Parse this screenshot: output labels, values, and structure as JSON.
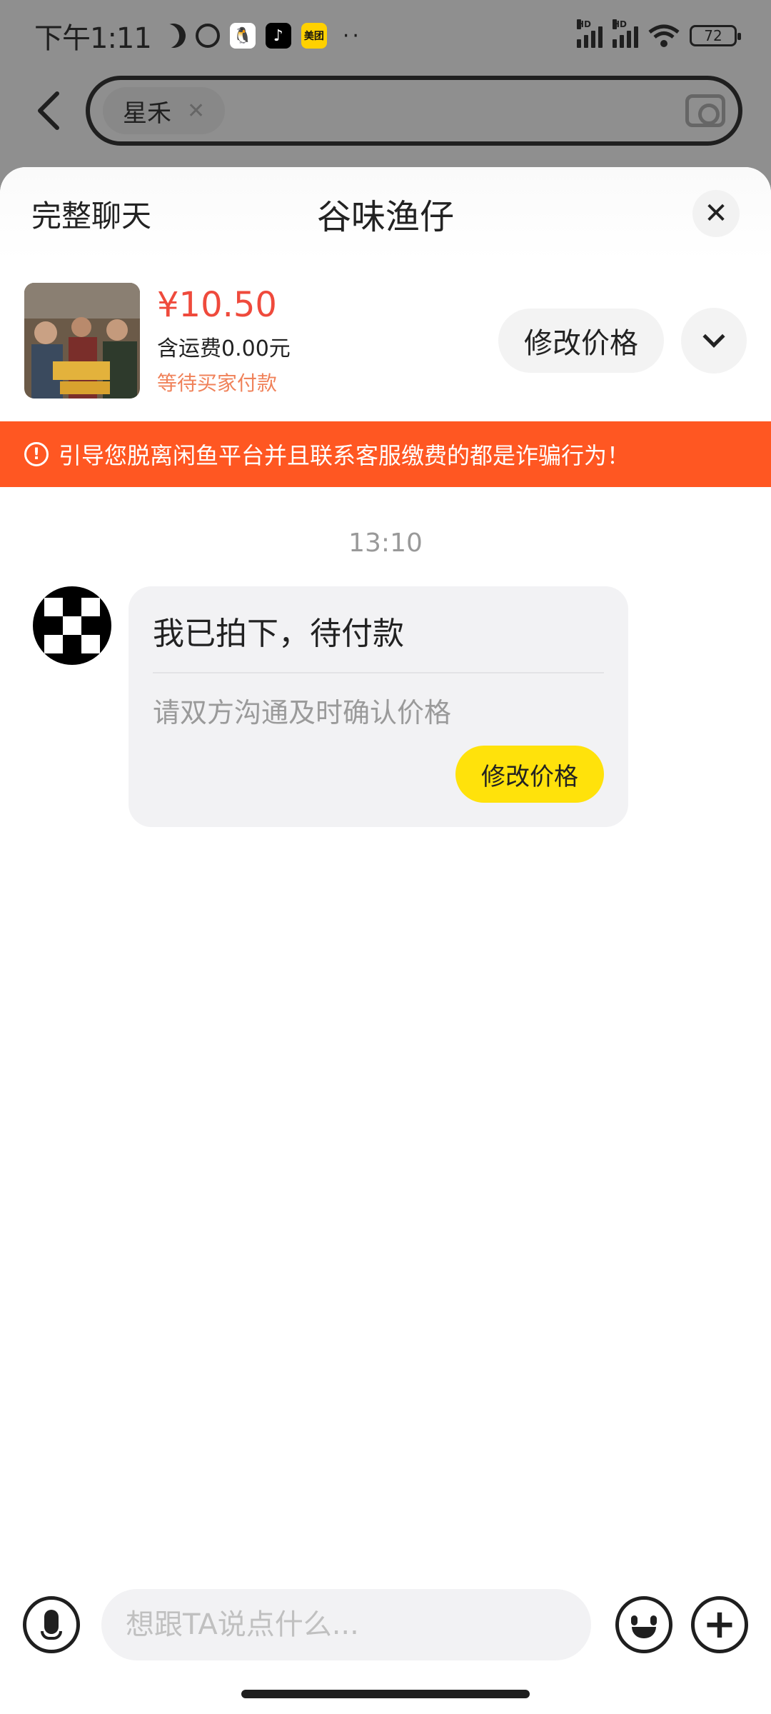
{
  "status_bar": {
    "time": "下午1:11",
    "meituan_label": "美团",
    "battery": "72",
    "signal_label": "HD"
  },
  "search": {
    "chip_label": "星禾"
  },
  "sheet": {
    "full_chat_label": "完整聊天",
    "title": "谷味渔仔"
  },
  "product": {
    "price": "¥10.50",
    "shipping": "含运费0.00元",
    "status": "等待买家付款",
    "modify_label": "修改价格"
  },
  "warning": {
    "text": "引导您脱离闲鱼平台并且联系客服缴费的都是诈骗行为！"
  },
  "chat": {
    "timestamp": "13:10",
    "message_title": "我已拍下，待付款",
    "message_sub": "请双方沟通及时确认价格",
    "message_button": "修改价格"
  },
  "input": {
    "placeholder": "想跟TA说点什么..."
  },
  "colors": {
    "price": "#ef4a3c",
    "warning_bg": "#ff5722",
    "accent_yellow": "#ffe20b"
  }
}
